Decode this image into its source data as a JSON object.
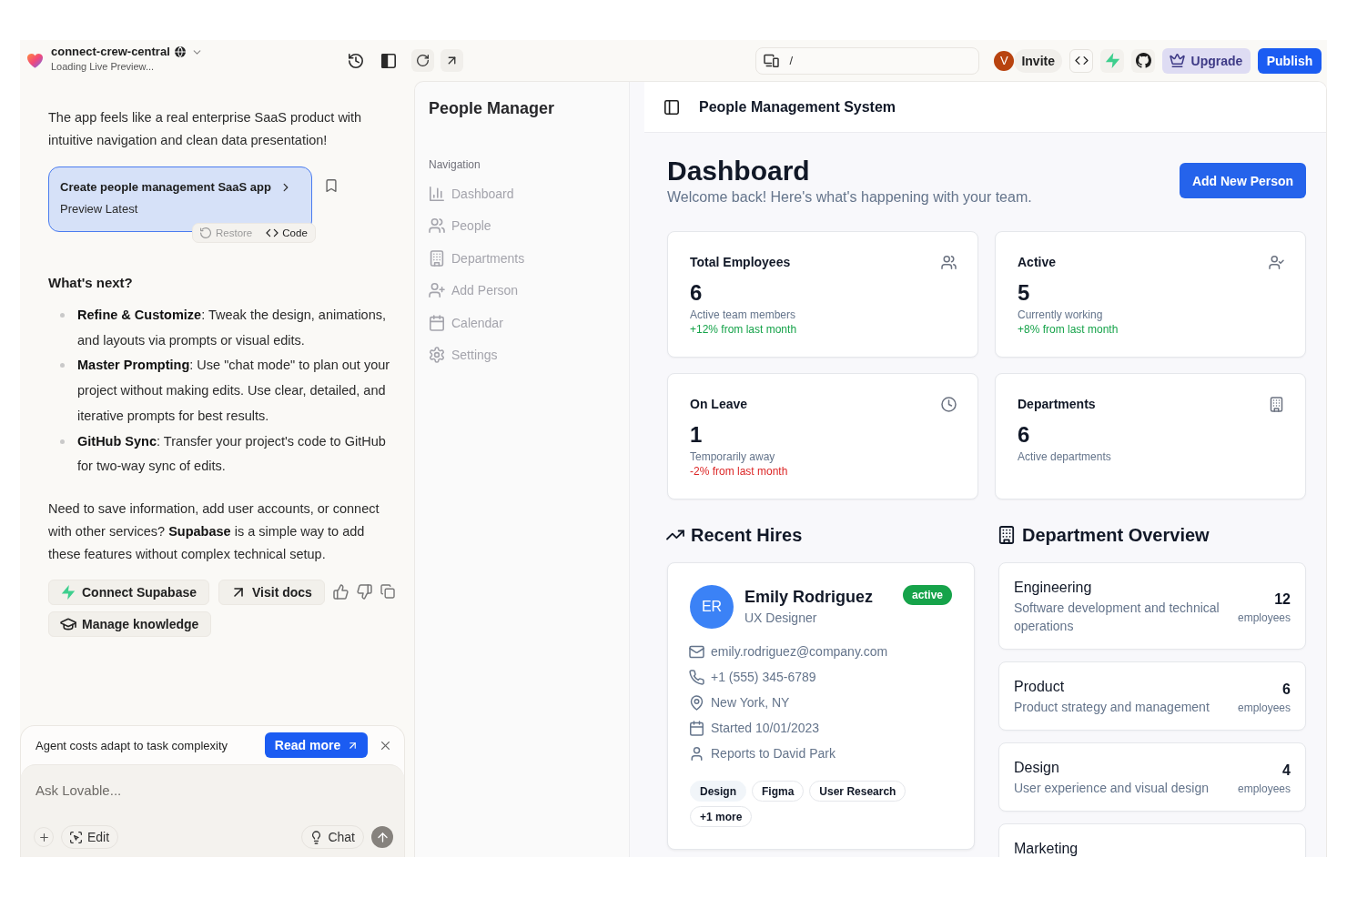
{
  "top_bar": {
    "project_name": "connect-crew-central",
    "status": "Loading Live Preview...",
    "address": "/",
    "avatar": "V",
    "invite": "Invite",
    "upgrade": "Upgrade",
    "publish": "Publish"
  },
  "chat": {
    "intro": "The app feels like a real enterprise SaaS product with intuitive navigation and clean data presentation!",
    "version": {
      "title": "Create people management SaaS app",
      "subtitle": "Preview Latest",
      "actions": [
        {
          "label": "Restore",
          "kind": "restore",
          "disabled": true
        },
        {
          "label": "Code",
          "kind": "code",
          "disabled": false
        }
      ]
    },
    "heading": "What's next?",
    "bullets": [
      "**Refine & Customize**: Tweak the design, animations, and layouts via prompts or visual edits.",
      "**Master Prompting**: Use \"chat mode\" to plan out your project without making edits. Use clear, detailed, and iterative prompts for best results.",
      "**GitHub Sync**: Transfer your project's code to GitHub for two-way sync of edits."
    ],
    "note": "Need to save information, add user accounts, or connect with other services? **Supabase** is a simple way to add these features without complex technical setup.",
    "actions": [
      {
        "label": "Connect Supabase",
        "kind": "supabase"
      },
      {
        "label": "Visit docs",
        "kind": "docs"
      },
      {
        "label": "Manage knowledge",
        "kind": "knowledge"
      }
    ],
    "notice": {
      "text": "Agent costs adapt to task complexity",
      "button": "Read more"
    },
    "composer": {
      "placeholder": "Ask Lovable...",
      "edit": "Edit",
      "chat": "Chat"
    }
  },
  "preview": {
    "sidebar": {
      "title": "People Manager",
      "section": "Navigation",
      "items": [
        {
          "label": "Dashboard",
          "kind": "dashboard",
          "disabled": true
        },
        {
          "label": "People",
          "kind": "people",
          "disabled": true
        },
        {
          "label": "Departments",
          "kind": "departments",
          "disabled": true
        },
        {
          "label": "Add Person",
          "kind": "add",
          "disabled": true
        },
        {
          "label": "Calendar",
          "kind": "calendar",
          "disabled": true
        },
        {
          "label": "Settings",
          "kind": "settings",
          "disabled": true
        }
      ]
    },
    "header": {
      "title": "People Management System"
    },
    "dashboard": {
      "title": "Dashboard",
      "subtitle": "Welcome back! Here's what's happening with your team.",
      "button": "Add New Person",
      "stats": [
        {
          "label": "Total Employees",
          "kind": "team",
          "value": "6",
          "caption": "Active team members",
          "change": "+12% from last month",
          "color": "#16a34a"
        },
        {
          "label": "Active",
          "kind": "active",
          "value": "5",
          "caption": "Currently working",
          "change": "+8% from last month",
          "color": "#16a34a"
        },
        {
          "label": "On Leave",
          "kind": "leave",
          "value": "1",
          "caption": "Temporarily away",
          "change": "-2% from last month",
          "color": "#dc2626"
        },
        {
          "label": "Departments",
          "kind": "departments",
          "value": "6",
          "caption": "Active departments"
        }
      ],
      "recent_hires": {
        "title": "Recent Hires",
        "people": [
          {
            "initials": "ER",
            "name": "Emily Rodriguez",
            "role": "UX Designer",
            "status": "active",
            "details": [
              {
                "kind": "email",
                "text": "emily.rodriguez@company.com"
              },
              {
                "kind": "phone",
                "text": "+1 (555) 345-6789"
              },
              {
                "kind": "location",
                "text": "New York, NY"
              },
              {
                "kind": "start",
                "text": "Started 10/01/2023"
              },
              {
                "kind": "manager",
                "text": "Reports to David Park"
              }
            ],
            "tags": [
              {
                "label": "Design",
                "kind": "secondary"
              },
              {
                "label": "Figma",
                "kind": "outline"
              },
              {
                "label": "User Research",
                "kind": "outline"
              },
              {
                "label": "+1 more",
                "kind": "outline"
              }
            ]
          }
        ]
      },
      "departments": {
        "title": "Department Overview",
        "items": [
          {
            "name": "Engineering",
            "description": "Software development and technical operations",
            "count": "12",
            "unit": "employees"
          },
          {
            "name": "Product",
            "description": "Product strategy and management",
            "count": "6",
            "unit": "employees"
          },
          {
            "name": "Design",
            "description": "User experience and visual design",
            "count": "4",
            "unit": "employees"
          },
          {
            "name": "Marketing"
          }
        ]
      }
    }
  }
}
